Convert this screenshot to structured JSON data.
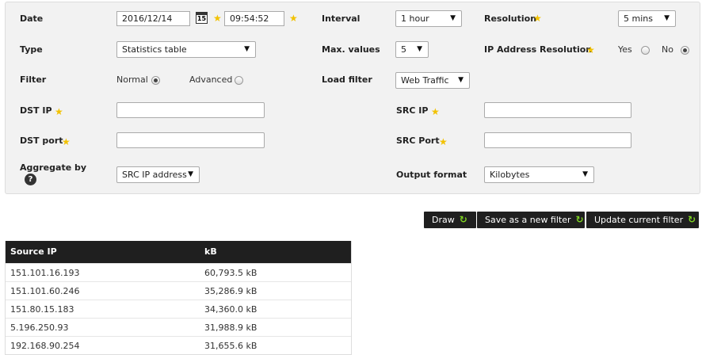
{
  "filters": {
    "date": {
      "label": "Date",
      "value": "2016/12/14",
      "calendar_day": "15",
      "time": "09:54:52"
    },
    "interval": {
      "label": "Interval",
      "value": "1 hour"
    },
    "resolution": {
      "label": "Resolution",
      "value": "5 mins"
    },
    "type": {
      "label": "Type",
      "value": "Statistics table"
    },
    "max_values": {
      "label": "Max. values",
      "value": "5"
    },
    "ip_resolution": {
      "label": "IP Address Resolution",
      "yes_label": "Yes",
      "no_label": "No",
      "selected": "No"
    },
    "filter": {
      "label": "Filter",
      "normal_label": "Normal",
      "advanced_label": "Advanced",
      "selected": "Normal"
    },
    "load_filter": {
      "label": "Load filter",
      "value": "Web Traffic"
    },
    "dst_ip": {
      "label": "DST IP",
      "value": ""
    },
    "src_ip": {
      "label": "SRC IP",
      "value": ""
    },
    "dst_port": {
      "label": "DST port",
      "value": ""
    },
    "src_port": {
      "label": "SRC Port",
      "value": ""
    },
    "aggregate_by": {
      "label": "Aggregate by",
      "help_icon": "?",
      "value": "SRC IP address"
    },
    "output_format": {
      "label": "Output format",
      "value": "Kilobytes"
    }
  },
  "actions": {
    "draw": "Draw",
    "save_new": "Save as a new filter",
    "update_current": "Update current filter"
  },
  "table": {
    "columns": [
      "Source IP",
      "kB"
    ],
    "rows": [
      [
        "151.101.16.193",
        "60,793.5 kB"
      ],
      [
        "151.101.60.246",
        "35,286.9 kB"
      ],
      [
        "151.80.15.183",
        "34,360.0 kB"
      ],
      [
        "5.196.250.93",
        "31,988.9 kB"
      ],
      [
        "192.168.90.254",
        "31,655.6 kB"
      ]
    ]
  },
  "icons": {
    "star": "star-icon",
    "calendar": "calendar-icon",
    "refresh": "refresh-icon",
    "help": "help-icon",
    "dropdown": "chevron-down-icon"
  },
  "colors": {
    "star": "#f2c200",
    "refresh": "#7ed321",
    "dark": "#1f1f1f",
    "panel": "#f2f2f2"
  }
}
